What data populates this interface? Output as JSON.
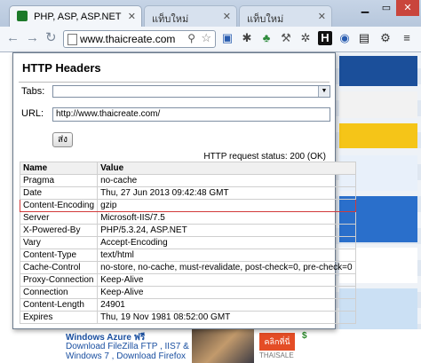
{
  "browser": {
    "tabs": [
      {
        "label": "PHP, ASP, ASP.NET",
        "active": true
      },
      {
        "label": "แท็บใหม่",
        "active": false
      },
      {
        "label": "แท็บใหม่",
        "active": false
      }
    ],
    "address": "www.thaicreate.com",
    "extension_h_label": "H"
  },
  "background_page": {
    "azure_text": "Windows Azure ฟรี",
    "links": [
      "Download FileZilla FTP , IIS7 &",
      "Windows 7 , Download Firefox"
    ],
    "thaisale_label": "คลิกที่นี่",
    "thaisale_brand": "THAISALE"
  },
  "popup": {
    "title": "HTTP Headers",
    "tabs_label": "Tabs:",
    "tabs_value": "",
    "url_label": "URL:",
    "url_value": "http://www.thaicreate.com/",
    "send_label": "ส่ง",
    "status_text": "HTTP request status: 200 (OK)",
    "columns": {
      "name": "Name",
      "value": "Value"
    },
    "rows": [
      {
        "name": "Pragma",
        "value": "no-cache"
      },
      {
        "name": "Date",
        "value": "Thu, 27 Jun 2013 09:42:48 GMT"
      },
      {
        "name": "Content-Encoding",
        "value": "gzip",
        "highlighted": true
      },
      {
        "name": "Server",
        "value": "Microsoft-IIS/7.5"
      },
      {
        "name": "X-Powered-By",
        "value": "PHP/5.3.24, ASP.NET"
      },
      {
        "name": "Vary",
        "value": "Accept-Encoding"
      },
      {
        "name": "Content-Type",
        "value": "text/html"
      },
      {
        "name": "Cache-Control",
        "value": "no-store, no-cache, must-revalidate, post-check=0, pre-check=0"
      },
      {
        "name": "Proxy-Connection",
        "value": "Keep-Alive"
      },
      {
        "name": "Connection",
        "value": "Keep-Alive"
      },
      {
        "name": "Content-Length",
        "value": "24901"
      },
      {
        "name": "Expires",
        "value": "Thu, 19 Nov 1981 08:52:00 GMT"
      }
    ],
    "highlight_color": "#d23b3b"
  }
}
